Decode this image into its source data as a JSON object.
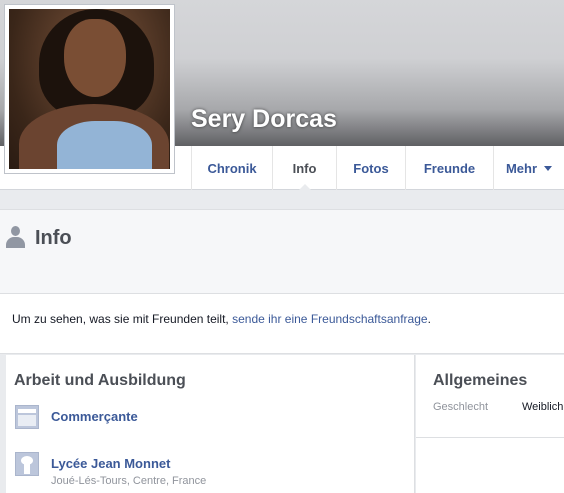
{
  "profile": {
    "name": "Sery Dorcas"
  },
  "nav": {
    "tabs": [
      {
        "label": "Chronik"
      },
      {
        "label": "Info"
      },
      {
        "label": "Fotos"
      },
      {
        "label": "Freunde"
      },
      {
        "label": "Mehr"
      }
    ],
    "active_tab": "Info"
  },
  "info_section": {
    "title": "Info",
    "notice_text": "Um zu sehen, was sie mit Freunden teilt, ",
    "notice_link": "sende ihr eine Freundschaftsanfrage",
    "notice_end": "."
  },
  "work_education": {
    "title": "Arbeit und Ausbildung",
    "entries": [
      {
        "name": "Commerçante",
        "sub": "",
        "icon": "briefcase-icon"
      },
      {
        "name": "Lycée Jean Monnet",
        "sub": "Joué-Lés-Tours, Centre, France",
        "icon": "school-icon"
      }
    ]
  },
  "general": {
    "title": "Allgemeines",
    "rows": [
      {
        "label": "Geschlecht",
        "value": "Weiblich"
      }
    ]
  },
  "colors": {
    "link": "#3b5998",
    "background": "#e9ebee",
    "heading": "#4b4f56"
  }
}
